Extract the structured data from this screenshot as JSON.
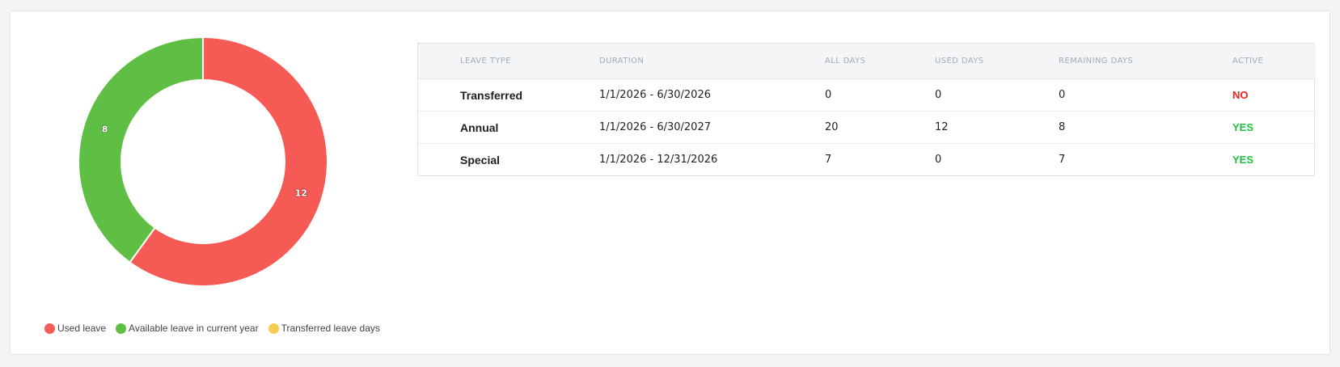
{
  "chart_data": {
    "type": "pie",
    "style": "donut",
    "slices": [
      {
        "label": "Used leave",
        "value": 12,
        "color": "#f55a55"
      },
      {
        "label": "Available leave in current year",
        "value": 8,
        "color": "#5fbf45"
      },
      {
        "label": "Transferred leave days",
        "value": 0,
        "color": "#f8cb52"
      }
    ],
    "data_labels": [
      "12",
      "8"
    ],
    "legend_placement": "bottom"
  },
  "legend": [
    {
      "label": "Used leave",
      "color": "#f55a55"
    },
    {
      "label": "Available leave in current year",
      "color": "#5fbf45"
    },
    {
      "label": "Transferred leave days",
      "color": "#f8cb52"
    }
  ],
  "table": {
    "headers": [
      "LEAVE TYPE",
      "DURATION",
      "ALL DAYS",
      "USED DAYS",
      "REMAINING DAYS",
      "ACTIVE"
    ],
    "rows": [
      {
        "type": "Transferred",
        "duration": "1/1/2026 - 6/30/2026",
        "all": "0",
        "used": "0",
        "remaining": "0",
        "active": "NO",
        "active_color": "#ee2222"
      },
      {
        "type": "Annual",
        "duration": "1/1/2026 - 6/30/2027",
        "all": "20",
        "used": "12",
        "remaining": "8",
        "active": "YES",
        "active_color": "#1fbf3f"
      },
      {
        "type": "Special",
        "duration": "1/1/2026 - 12/31/2026",
        "all": "7",
        "used": "0",
        "remaining": "7",
        "active": "YES",
        "active_color": "#1fbf3f"
      }
    ]
  }
}
